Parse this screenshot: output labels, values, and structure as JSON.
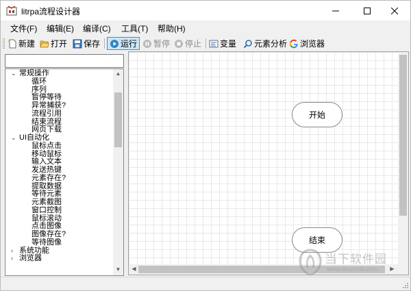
{
  "window": {
    "title": "litrpa流程设计器"
  },
  "menu": [
    {
      "label": "文件(F)"
    },
    {
      "label": "编辑(E)"
    },
    {
      "label": "编译(C)"
    },
    {
      "label": "工具(T)"
    },
    {
      "label": "帮助(H)"
    }
  ],
  "toolbar": {
    "new_label": "新建",
    "open_label": "打开",
    "save_label": "保存",
    "run_label": "运行",
    "pause_label": "暂停",
    "stop_label": "停止",
    "variable_label": "变量",
    "element_label": "元素分析",
    "browser_label": "浏览器"
  },
  "search": {
    "value": ""
  },
  "tree": {
    "groups": [
      {
        "label": "常规操作",
        "expanded": true,
        "items": [
          "循环",
          "序列",
          "暂停等待",
          "异常捕获?",
          "流程引用",
          "结束流程",
          "网页下载"
        ]
      },
      {
        "label": "UI自动化",
        "expanded": true,
        "items": [
          "鼠标点击",
          "移动鼠标",
          "输入文本",
          "发送热键",
          "元素存在?",
          "提取数据",
          "等待元素",
          "元素截图",
          "窗口控制",
          "鼠标滚动",
          "点击图像",
          "图像存在?",
          "等待图像"
        ]
      },
      {
        "label": "系统功能",
        "expanded": false,
        "items": []
      },
      {
        "label": "浏览器",
        "expanded": false,
        "items": []
      }
    ]
  },
  "canvas": {
    "start_node": "开始",
    "end_node": "结束"
  },
  "watermark": {
    "main": "当下软件园",
    "sub": "www.downxia.com"
  },
  "colors": {
    "run_active_bg": "#cde6f7",
    "run_active_border": "#3b8fd0",
    "browser_icon": "#4285f4"
  }
}
